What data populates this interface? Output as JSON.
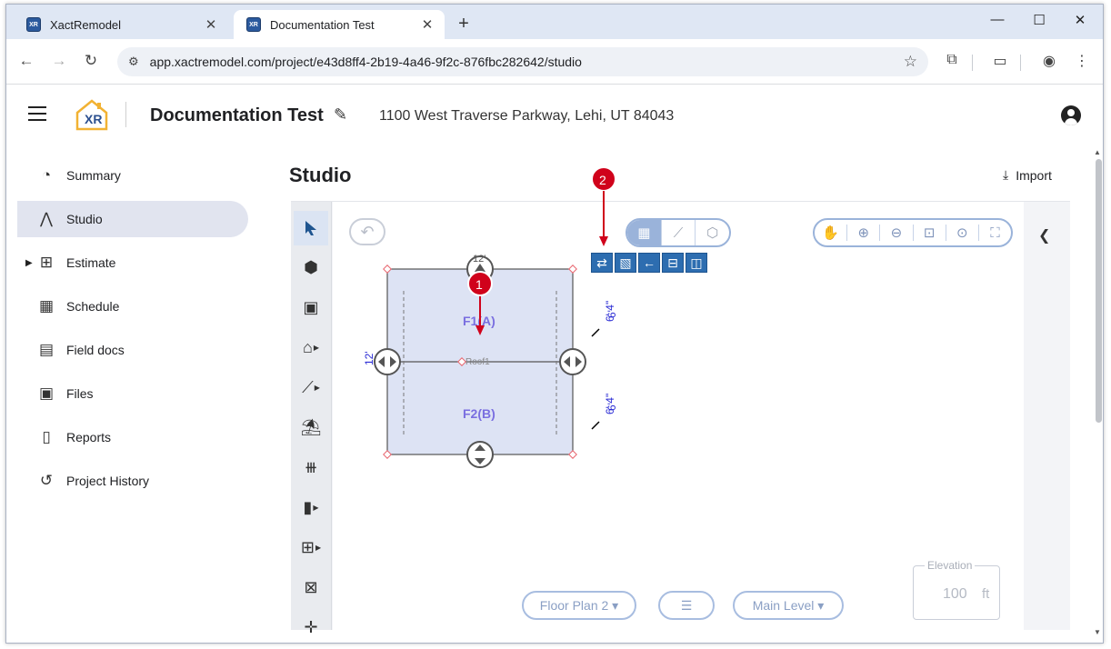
{
  "browser": {
    "tabs": [
      {
        "title": "XactRemodel",
        "close": "✕"
      },
      {
        "title": "Documentation Test",
        "close": "✕"
      }
    ],
    "new_tab": "+",
    "window_controls": {
      "minimize": "—",
      "maximize": "☐",
      "close": "✕"
    },
    "url": "app.xactremodel.com/project/e43d8ff4-2b19-4a46-9f2c-876fbc282642/studio",
    "favicon_text": "XR"
  },
  "header": {
    "logo_text": "XR",
    "project_title": "Documentation Test",
    "address": "1100 West Traverse Parkway, Lehi, UT 84043"
  },
  "sidebar": {
    "items": [
      {
        "label": "Summary",
        "icon": "speedometer-icon"
      },
      {
        "label": "Studio",
        "icon": "compass-icon"
      },
      {
        "label": "Estimate",
        "icon": "calculator-icon"
      },
      {
        "label": "Schedule",
        "icon": "calendar-icon"
      },
      {
        "label": "Field docs",
        "icon": "clipboard-icon"
      },
      {
        "label": "Files",
        "icon": "images-icon"
      },
      {
        "label": "Reports",
        "icon": "document-icon"
      },
      {
        "label": "Project History",
        "icon": "history-icon"
      }
    ]
  },
  "studio": {
    "title": "Studio",
    "import_label": "Import",
    "floor_plan": "Floor Plan 2 ▾",
    "level": "Main Level ▾",
    "elevation": {
      "label": "Elevation",
      "value": "100",
      "unit": "ft"
    },
    "rooms": [
      {
        "label": "F1(A)"
      },
      {
        "label": "F2(B)"
      }
    ],
    "roof_label": "Roof1",
    "dims": {
      "left": "12'",
      "top": "12'",
      "right_upper_a": "6' 4\"",
      "right_upper_b": "6'",
      "right_lower_a": "6' 4\"",
      "right_lower_b": "6'"
    },
    "callouts": [
      "1",
      "2"
    ]
  },
  "colors": {
    "accent": "#2d6db0",
    "callout": "#d0021b",
    "room_fill": "#dde3f4",
    "room_label": "#7a6fe0",
    "dim_text": "#2a2bd4"
  }
}
